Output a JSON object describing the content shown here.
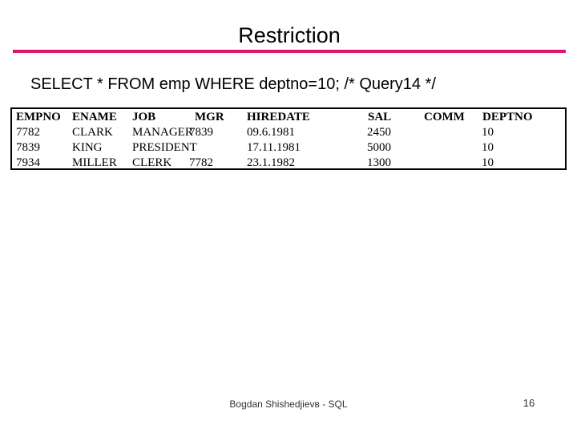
{
  "slide": {
    "title": "Restriction",
    "accent_color": "#e0156f",
    "background_color": "#ffffff",
    "text_color": "#000000"
  },
  "query": {
    "text": "SELECT * FROM emp WHERE deptno=10; /* Query14 */"
  },
  "result_table": {
    "columns": [
      {
        "key": "empno",
        "label": "EMPNO"
      },
      {
        "key": "ename",
        "label": "ENAME"
      },
      {
        "key": "job",
        "label": "JOB"
      },
      {
        "key": "mgr",
        "label": "MGR"
      },
      {
        "key": "hiredate",
        "label": "HIREDATE"
      },
      {
        "key": "sal",
        "label": "SAL"
      },
      {
        "key": "comm",
        "label": "COMM"
      },
      {
        "key": "deptno",
        "label": "DEPTNO"
      }
    ],
    "rows": [
      {
        "empno": "7782",
        "ename": "CLARK",
        "job": "MANAGER",
        "mgr": "7839",
        "hiredate": "09.6.1981",
        "sal": "2450",
        "comm": "",
        "deptno": "10"
      },
      {
        "empno": "7839",
        "ename": "KING",
        "job": "PRESIDENT",
        "mgr": "",
        "hiredate": "17.11.1981",
        "sal": "5000",
        "comm": "",
        "deptno": "10"
      },
      {
        "empno": "7934",
        "ename": "MILLER",
        "job": "CLERK",
        "mgr": "7782",
        "hiredate": "23.1.1982",
        "sal": "1300",
        "comm": "",
        "deptno": "10"
      }
    ]
  },
  "footer": {
    "author": "Bogdan Shishedjievв - SQL",
    "page_number": "16"
  }
}
